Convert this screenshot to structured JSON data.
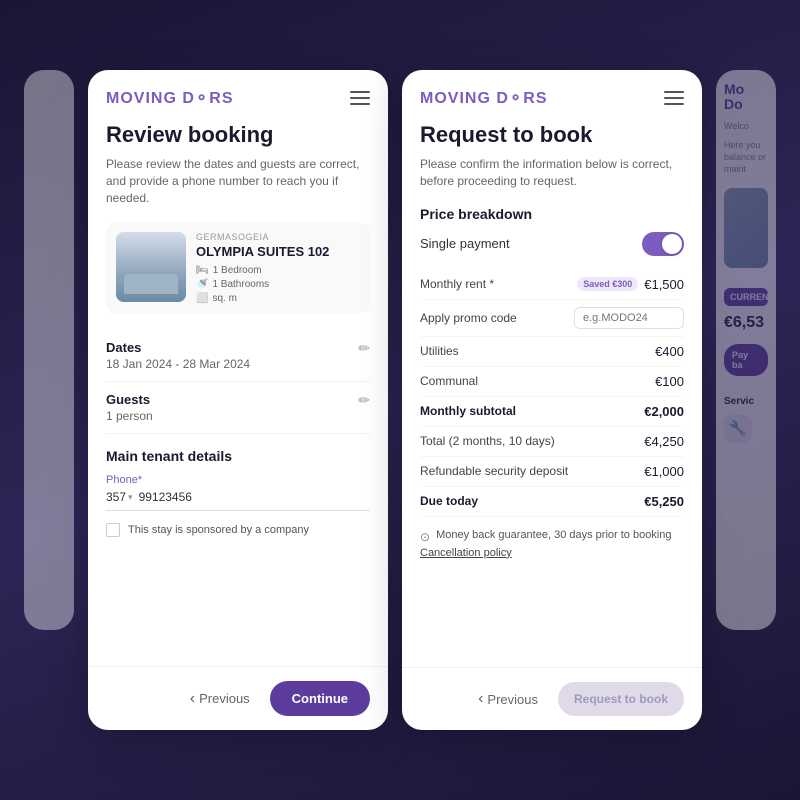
{
  "app": {
    "logo": "MOVING DOORS"
  },
  "left_card": {
    "header": {
      "logo": "MOVING D⚬RS",
      "menu_label": "menu"
    },
    "title": "Review booking",
    "subtitle": "Please review the dates and guests are correct, and provide a phone number to reach you if needed.",
    "property": {
      "location": "GERMASOGEIA",
      "name": "OLYMPIA SUITES 102",
      "bedrooms": "1 Bedroom",
      "bathrooms": "1 Bathrooms",
      "size": "sq. m"
    },
    "dates": {
      "label": "Dates",
      "value": "18 Jan 2024 - 28 Mar 2024"
    },
    "guests": {
      "label": "Guests",
      "value": "1 person"
    },
    "tenant_section": {
      "title": "Main tenant details",
      "phone_label": "Phone*",
      "phone_country_code": "357",
      "phone_number": "99123456",
      "company_checkbox": "This stay is sponsored by a company"
    },
    "footer": {
      "previous_label": "Previous",
      "continue_label": "Continue"
    }
  },
  "right_card": {
    "header": {
      "logo": "MOVING D⚬RS",
      "menu_label": "menu"
    },
    "title": "Request to book",
    "subtitle": "Please confirm the information below is correct, before proceeding to request.",
    "price_section": {
      "title": "Price breakdown",
      "single_payment_label": "Single payment",
      "rows": [
        {
          "label": "Monthly rent *",
          "badge": "Saved €300",
          "value": "€1,500",
          "bold": false
        },
        {
          "label": "Apply promo code",
          "placeholder": "e.g.MODO24",
          "is_promo": true,
          "value": "",
          "bold": false
        },
        {
          "label": "Utilities",
          "value": "€400",
          "bold": false
        },
        {
          "label": "Communal",
          "value": "€100",
          "bold": false
        },
        {
          "label": "Monthly subtotal",
          "value": "€2,000",
          "bold": true
        },
        {
          "label": "Total (2 months, 10 days)",
          "value": "€4,250",
          "bold": false
        },
        {
          "label": "Refundable security deposit",
          "value": "€1,000",
          "bold": false
        },
        {
          "label": "Due today",
          "value": "€5,250",
          "bold": true
        }
      ],
      "money_back_text": "Money back guarantee, 30 days prior to booking",
      "cancellation_link": "Cancellation policy"
    },
    "footer": {
      "previous_label": "Previous",
      "request_label": "Request to book"
    }
  },
  "partial_right": {
    "logo_line1": "Mo",
    "logo_line2": "Do",
    "welcome_text": "Welco",
    "body_text": "Here you balance or maint",
    "current_label": "CURRENT",
    "amount": "€6,53",
    "pay_btn": "Pay ba",
    "service_label": "Servic"
  }
}
